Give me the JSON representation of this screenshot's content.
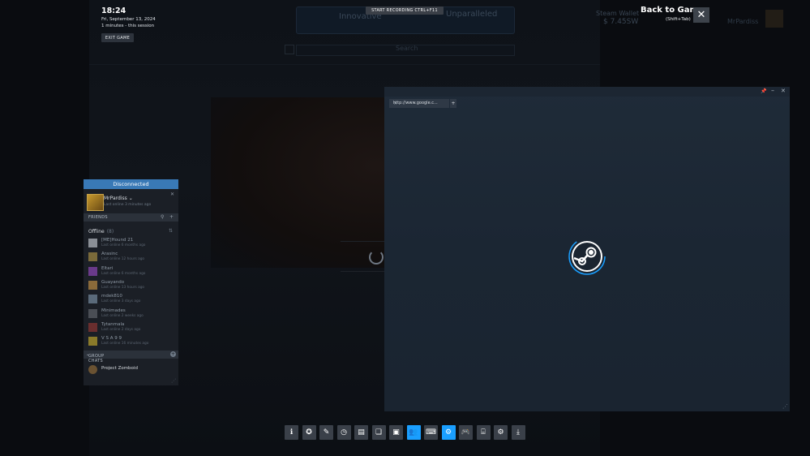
{
  "overlay": {
    "time": "18:24",
    "date": "Fri, September 13, 2024",
    "session": "1 minutes - this session",
    "exit_label": "EXIT GAME",
    "record_label": "START RECORDING CTRL+F11",
    "back_title": "Back to Game",
    "back_shortcut": "(Shift+Tab)"
  },
  "background": {
    "banner_left": "Innovative",
    "banner_right": "Unparalleled",
    "search_placeholder": "Search",
    "wallet_label": "Steam Wallet",
    "wallet_value": "$ 7.45SW",
    "username": "MrPardiss"
  },
  "friends": {
    "status_bar": "Disconnected",
    "me": {
      "name": "MrPardiss",
      "status": "Last online 3 minutes ago"
    },
    "header_label": "FRIENDS",
    "offline_label": "Offline",
    "offline_count": "(8)",
    "list": [
      {
        "name": "[ME]Hound 21",
        "last": "Last online 6 months ago",
        "color": "#8a8f96"
      },
      {
        "name": "Arasinc",
        "last": "Last online 12 hours ago",
        "color": "#7a6a3a"
      },
      {
        "name": "Eltari",
        "last": "Last online 6 months ago",
        "color": "#6a3a8a"
      },
      {
        "name": "Guayando",
        "last": "Last online 13 hours ago",
        "color": "#8a6a3a"
      },
      {
        "name": "mdek810",
        "last": "Last online 3 days ago",
        "color": "#5a6a7a"
      },
      {
        "name": "Minimades",
        "last": "Last online 2 weeks ago",
        "color": "#4a4e55"
      },
      {
        "name": "Tytanmala",
        "last": "Last online 2 days ago",
        "color": "#6a2e2e"
      },
      {
        "name": "V S A 9 9",
        "last": "Last online 16 minutes ago",
        "color": "#8a7a2a"
      }
    ],
    "group_header": "GROUP CHATS",
    "group_name": "Project Zomboid"
  },
  "browser": {
    "tab_url": "http://www.google.c...",
    "new_tab": "+"
  },
  "toolbar": {
    "buttons": [
      "info-icon",
      "achievements-icon",
      "notes-icon",
      "clock-icon",
      "guides-icon",
      "discussions-icon",
      "screenshots-icon",
      "friends-icon",
      "controller-icon",
      "steam-icon",
      "gamepad-icon",
      "keyboard-icon",
      "settings-icon",
      "download-icon"
    ],
    "active": [
      "friends-icon",
      "steam-icon"
    ]
  },
  "colors": {
    "accent": "#1a9fff",
    "disconnected_bar": "#3979b6"
  }
}
